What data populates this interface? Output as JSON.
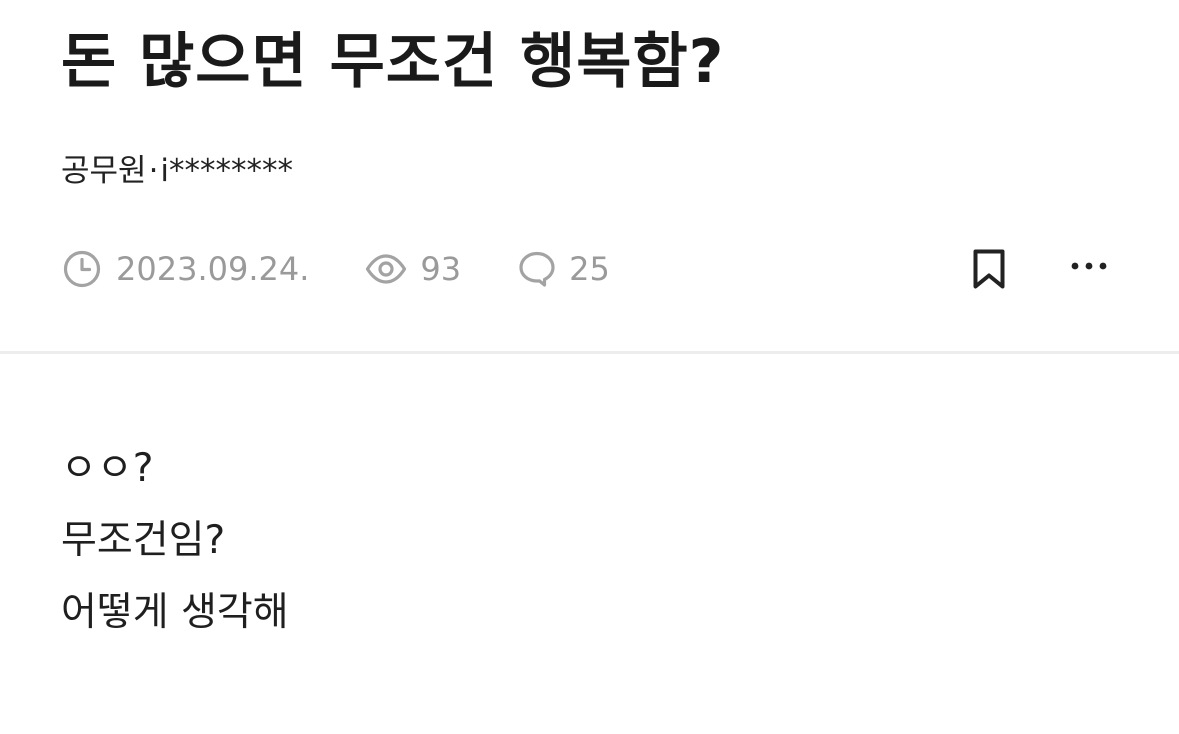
{
  "post": {
    "title": "돈 많으면 무조건 행복함?",
    "author": {
      "job": "공무원",
      "separator": "·",
      "nickname": "i********"
    },
    "meta": {
      "date": "2023.09.24.",
      "views": "93",
      "comments": "25",
      "date_icon": "clock-icon",
      "views_icon": "eye-icon",
      "comments_icon": "speech-bubble-icon"
    },
    "actions": {
      "bookmark_icon": "bookmark-icon",
      "more_icon": "more-horizontal-icon"
    },
    "content_lines": [
      "ㅇㅇ?",
      "무조건임?",
      "어떻게 생각해"
    ]
  },
  "colors": {
    "text_primary": "#1a1a1a",
    "text_meta": "#9a9a9a",
    "divider": "#ededed",
    "background": "#ffffff"
  }
}
